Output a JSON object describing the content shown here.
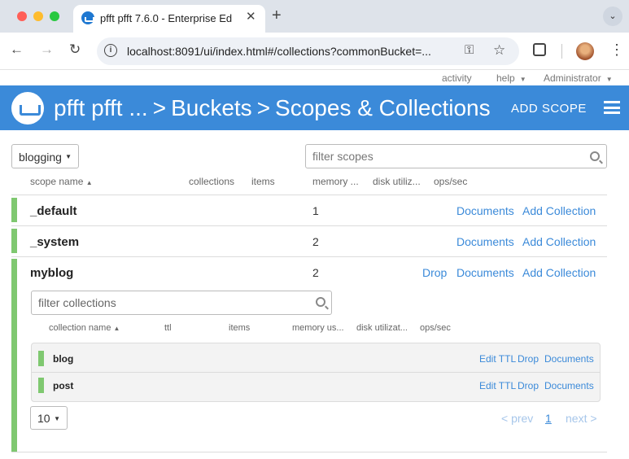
{
  "browser": {
    "tab_title": "pfft pfft 7.6.0 - Enterprise Ed",
    "tab_close": "✕",
    "new_tab": "+",
    "url": "localhost:8091/ui/index.html#/collections?commonBucket=..."
  },
  "topnav": {
    "activity": "activity",
    "help": "help",
    "user": "Administrator"
  },
  "header": {
    "cluster": "pfft pfft ...",
    "sep1": ">",
    "buckets": "Buckets",
    "sep2": ">",
    "page": "Scopes & Collections",
    "add_scope": "ADD SCOPE"
  },
  "bucket_select": {
    "value": "blogging"
  },
  "filter_scopes": {
    "placeholder": "filter scopes"
  },
  "scope_columns": [
    "scope name",
    "collections",
    "items",
    "memory ...",
    "disk utiliz...",
    "ops/sec"
  ],
  "scopes": [
    {
      "name": "_default",
      "memory": "1",
      "documents": "Documents",
      "add": "Add Collection"
    },
    {
      "name": "_system",
      "memory": "2",
      "documents": "Documents",
      "add": "Add Collection"
    },
    {
      "name": "myblog",
      "memory": "2",
      "drop": "Drop",
      "documents": "Documents",
      "add": "Add Collection"
    }
  ],
  "filter_collections": {
    "placeholder": "filter collections"
  },
  "collection_columns": [
    "collection name",
    "ttl",
    "items",
    "memory us...",
    "disk utilizat...",
    "ops/sec"
  ],
  "collections": [
    {
      "name": "blog",
      "edit": "Edit TTL",
      "drop": "Drop",
      "docs": "Documents"
    },
    {
      "name": "post",
      "edit": "Edit TTL",
      "drop": "Drop",
      "docs": "Documents"
    }
  ],
  "pagination": {
    "page_size": "10",
    "prev": "< prev",
    "current": "1",
    "next": "next >"
  },
  "colors": {
    "brand": "#3b8ad9",
    "scope_bar": "#7fc870"
  }
}
